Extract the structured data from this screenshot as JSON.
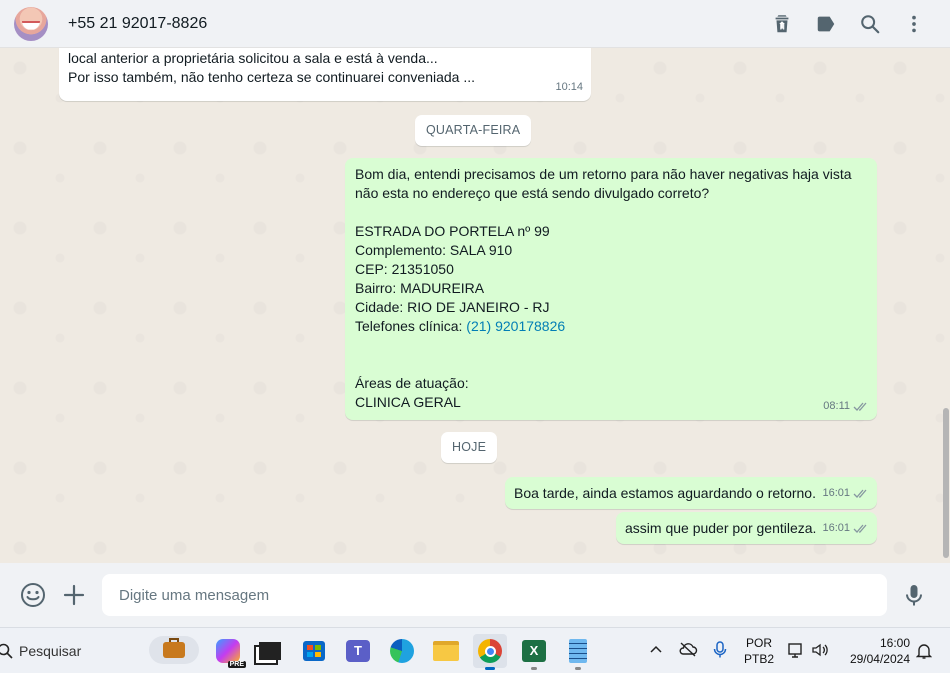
{
  "header": {
    "contact_name": "+55 21 92017-8826"
  },
  "messages": [
    {
      "direction": "in",
      "lines": "local anterior a proprietária solicitou a sala e está à venda...\nPor isso também, não tenho certeza se continuarei conveniada ...",
      "time": "10:14"
    },
    {
      "direction": "out",
      "text_before_link": "Bom dia, entendi precisamos de um retorno para não haver negativas haja vista\nnão esta no endereço que está sendo divulgado correto?\n\nESTRADA DO PORTELA nº 99\nComplemento: SALA 910\nCEP: 21351050\nBairro: MADUREIRA\nCidade: RIO DE JANEIRO - RJ\nTelefones clínica: ",
      "link": "(21) 920178826",
      "text_after_link": "\n\n\nÁreas de atuação:\nCLINICA GERAL",
      "time": "08:11"
    },
    {
      "direction": "out",
      "text": "Boa tarde, ainda estamos aguardando o retorno.",
      "time": "16:01"
    },
    {
      "direction": "out",
      "text": "assim que puder por gentileza.",
      "time": "16:01"
    }
  ],
  "day_separators": [
    "QUARTA-FEIRA",
    "HOJE"
  ],
  "composer": {
    "placeholder": "Digite uma mensagem"
  },
  "taskbar": {
    "search_label": "Pesquisar",
    "language": "POR",
    "keyboard": "PTB2",
    "time": "16:00",
    "date": "29/04/2024",
    "copilot_badge": "PRE"
  },
  "colors": {
    "outgoing_bubble": "#d9fdd3",
    "incoming_bubble": "#ffffff",
    "chat_background": "#efeae2",
    "read_ticks": "#8696a0",
    "link": "#027eb5"
  }
}
